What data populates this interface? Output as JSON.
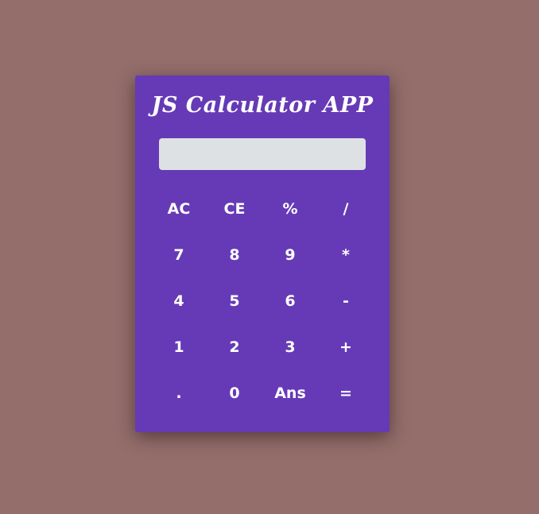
{
  "app": {
    "title": "JS Calculator APP"
  },
  "display": {
    "value": ""
  },
  "keys": [
    [
      "AC",
      "CE",
      "%",
      "/"
    ],
    [
      "7",
      "8",
      "9",
      "*"
    ],
    [
      "4",
      "5",
      "6",
      "-"
    ],
    [
      "1",
      "2",
      "3",
      "+"
    ],
    [
      ".",
      "0",
      "Ans",
      "="
    ]
  ],
  "colors": {
    "page_background": "#936e6b",
    "calculator_background": "#663ab6",
    "display_background": "#dee1e3",
    "key_text": "#ffffff"
  }
}
